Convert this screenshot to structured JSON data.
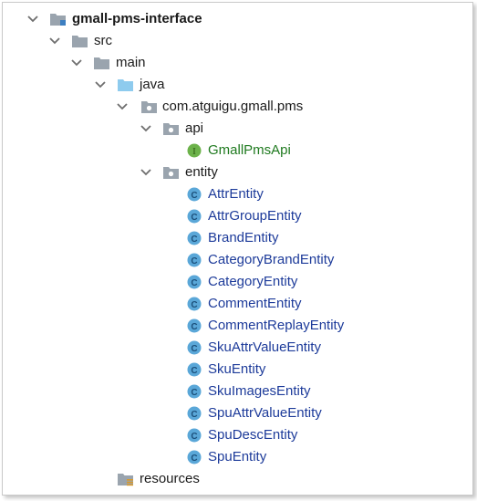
{
  "project": {
    "name": "gmall-pms-interface",
    "colors": {
      "folder": "#9aa4ae",
      "source_folder": "#8ecbee",
      "class_icon": "#5aa7d8",
      "interface_icon": "#6cb24a",
      "class_text": "#1d3b9a",
      "interface_text": "#1f7a1f"
    },
    "nodes": {
      "root": {
        "label": "gmall-pms-interface",
        "icon": "module-folder-icon"
      },
      "src": {
        "label": "src",
        "icon": "folder-icon"
      },
      "main": {
        "label": "main",
        "icon": "folder-icon"
      },
      "java": {
        "label": "java",
        "icon": "source-folder-icon"
      },
      "package": {
        "label": "com.atguigu.gmall.pms",
        "icon": "package-icon"
      },
      "api": {
        "label": "api",
        "icon": "package-icon"
      },
      "api_iface": {
        "label": "GmallPmsApi",
        "icon": "interface-icon",
        "badge": "I"
      },
      "entity": {
        "label": "entity",
        "icon": "package-icon"
      },
      "resources": {
        "label": "resources",
        "icon": "resources-folder-icon"
      }
    },
    "entity_badge": "C",
    "entity_classes": [
      "AttrEntity",
      "AttrGroupEntity",
      "BrandEntity",
      "CategoryBrandEntity",
      "CategoryEntity",
      "CommentEntity",
      "CommentReplayEntity",
      "SkuAttrValueEntity",
      "SkuEntity",
      "SkuImagesEntity",
      "SpuAttrValueEntity",
      "SpuDescEntity",
      "SpuEntity"
    ]
  }
}
